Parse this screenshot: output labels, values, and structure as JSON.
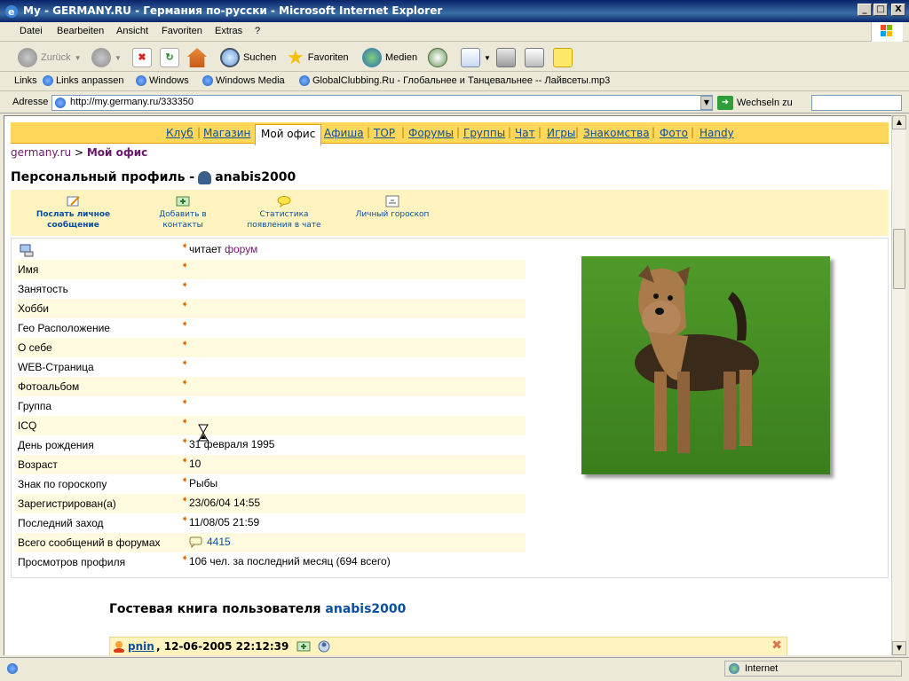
{
  "window": {
    "title": "My - GERMANY.RU - Германия по-русски - Microsoft Internet Explorer",
    "min": "_",
    "max": "□",
    "close": "X"
  },
  "menubar": [
    "Datei",
    "Bearbeiten",
    "Ansicht",
    "Favoriten",
    "Extras",
    "?"
  ],
  "toolbar": {
    "back": "Zurück",
    "search": "Suchen",
    "favorites": "Favoriten",
    "media": "Medien"
  },
  "links": {
    "label": "Links",
    "items": [
      "Links anpassen",
      "Windows",
      "Windows Media",
      "GlobalClubbing.Ru - Глобальнее и Танцевальнее -- Лайвсеты.mp3"
    ]
  },
  "address": {
    "label": "Adresse",
    "url": "http://my.germany.ru/333350",
    "go": "Wechseln zu"
  },
  "nav": {
    "items": [
      "Клуб",
      "Магазин",
      "Мой офис",
      "Афиша",
      "TOP",
      "Форумы",
      "Группы",
      "Чат",
      "Игры",
      "Знакомства",
      "Фото",
      "Handy"
    ],
    "active": "Мой офис"
  },
  "breadcrumb": {
    "root": "germany.ru",
    "sep": ">",
    "current": "Мой офис"
  },
  "profile": {
    "title": "Персональный профиль -",
    "username": "anabis2000",
    "actions": [
      {
        "line1": "Послать личное",
        "line2": "сообщение"
      },
      {
        "line1": "Добавить в",
        "line2": "контакты"
      },
      {
        "line1": "Статистика",
        "line2": "появления в чате"
      },
      {
        "line1": "Личный гороскоп",
        "line2": ""
      }
    ],
    "status_prefix": "читает",
    "status_link": "форум",
    "rows": [
      {
        "label": "Имя",
        "value": ""
      },
      {
        "label": "Занятость",
        "value": ""
      },
      {
        "label": "Хобби",
        "value": ""
      },
      {
        "label": "Гео Расположение",
        "value": ""
      },
      {
        "label": "О себе",
        "value": ""
      },
      {
        "label": "WEB-Страница",
        "value": ""
      },
      {
        "label": "Фотоальбом",
        "value": ""
      },
      {
        "label": "Группа",
        "value": ""
      },
      {
        "label": "ICQ",
        "value": ""
      },
      {
        "label": "День рождения",
        "value": "31 февраля 1995"
      },
      {
        "label": "Возраст",
        "value": "10"
      },
      {
        "label": "Знак по гороскопу",
        "value": "Рыбы"
      },
      {
        "label": "Зарегистрирован(а)",
        "value": "23/06/04 14:55"
      },
      {
        "label": "Последний заход",
        "value": "11/08/05 21:59"
      },
      {
        "label": "Всего сообщений в форумах",
        "value": "4415"
      },
      {
        "label": "Просмотров профиля",
        "value": "106 чел. за последний месяц (694 всего)"
      }
    ]
  },
  "guestbook": {
    "title": "Гостевая книга пользователя",
    "user": "anabis2000",
    "entry": {
      "name": "pnin",
      "date": ", 12-06-2005 22:12:39"
    }
  },
  "status": {
    "zone": "Internet"
  },
  "colors": {
    "nav_bg": "#ffd75a",
    "action_bg": "#fff4c0",
    "link": "#0b4fa0",
    "visited": "#6a1a6a"
  }
}
